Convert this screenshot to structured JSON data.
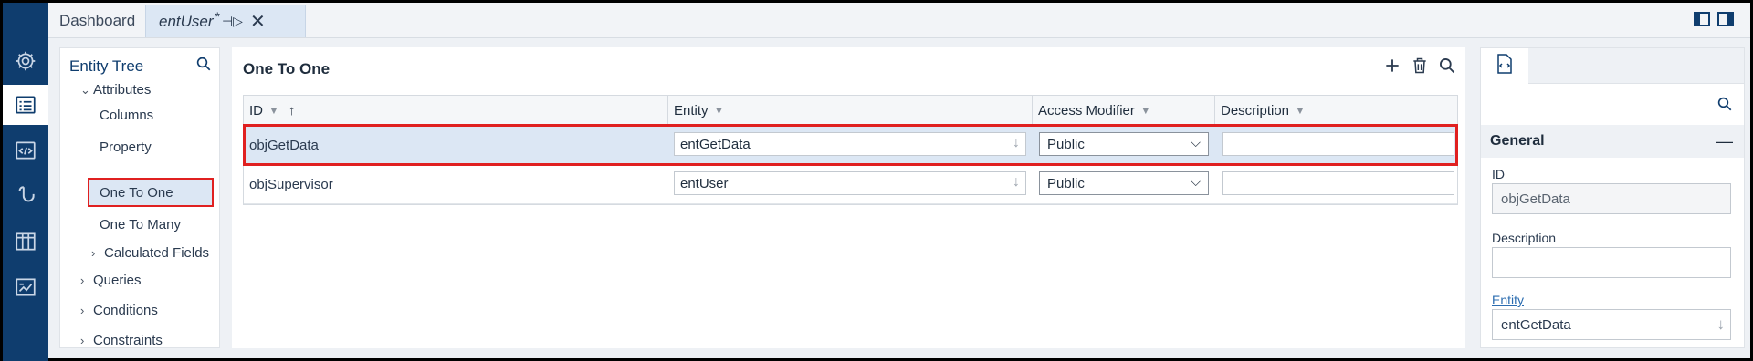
{
  "tabs": {
    "dashboard": "Dashboard",
    "entity": "entUser",
    "modified_mark": "*",
    "pin_glyph": "⊣▷",
    "close_glyph": "✕"
  },
  "rail": {
    "items": [
      "settings-icon",
      "entity-list-icon",
      "code-icon",
      "hook-icon",
      "table-icon",
      "chart-icon"
    ],
    "active_index": 1
  },
  "tree": {
    "title": "Entity Tree",
    "nodes": {
      "attributes": "Attributes",
      "columns": "Columns",
      "property": "Property",
      "one_to_one": "One To One",
      "one_to_many": "One To Many",
      "calculated_fields": "Calculated Fields",
      "queries": "Queries",
      "conditions": "Conditions",
      "constraints": "Constraints"
    },
    "selected": "One To One"
  },
  "main": {
    "title": "One To One",
    "columns": {
      "id": "ID",
      "entity": "Entity",
      "access_modifier": "Access Modifier",
      "description": "Description"
    },
    "sort_glyph": "↑",
    "rows": [
      {
        "id": "objGetData",
        "entity": "entGetData",
        "access": "Public",
        "description": ""
      },
      {
        "id": "objSupervisor",
        "entity": "entUser",
        "access": "Public",
        "description": ""
      }
    ]
  },
  "props": {
    "section": "General",
    "collapse_glyph": "—",
    "id_label": "ID",
    "id_value": "objGetData",
    "description_label": "Description",
    "description_value": "",
    "entity_label": "Entity",
    "entity_value": "entGetData"
  },
  "colors": {
    "rail": "#0f3d6e",
    "highlight": "#e02020",
    "selected_row": "#dce7f4"
  }
}
